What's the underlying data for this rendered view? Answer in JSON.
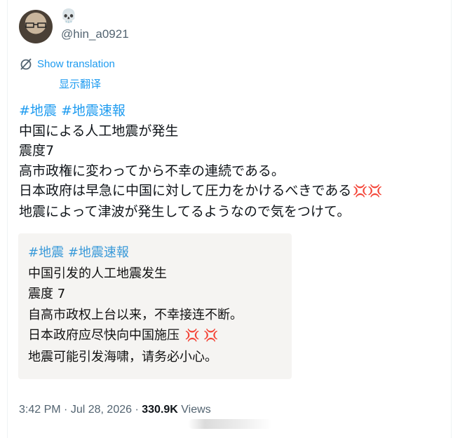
{
  "user": {
    "emoji": "💀",
    "handle": "@hin_a0921"
  },
  "translation": {
    "show_label": "Show translation",
    "cn_label": "显示翻译"
  },
  "tweet": {
    "hashtags": [
      "#地震",
      "#地震速報"
    ],
    "lines": [
      "中国による人工地震が発生",
      "震度7",
      "高市政権に変わってから不幸の連続である。",
      "日本政府は早急に中国に対して圧力をかけるべきである",
      "地震によって津波が発生してるようなので気をつけて。"
    ],
    "anger_emoji": "💢💢"
  },
  "quote": {
    "hashtags": [
      "#地震",
      "#地震速報"
    ],
    "lines": [
      "中国引发的人工地震发生",
      "震度 7",
      "自高市政权上台以来，不幸接连不断。",
      "日本政府应尽快向中国施压",
      "地震可能引发海啸，请务必小心。"
    ],
    "anger_emoji": "💢 💢"
  },
  "meta": {
    "time": "3:42 PM",
    "separator": "·",
    "date": "Jul 28, 2026",
    "views_count": "330.9K",
    "views_label": "Views"
  },
  "colors": {
    "link": "#1d9bf0",
    "text": "#0f1419",
    "secondary": "#536471",
    "quote_bg": "#f5f4f2"
  }
}
